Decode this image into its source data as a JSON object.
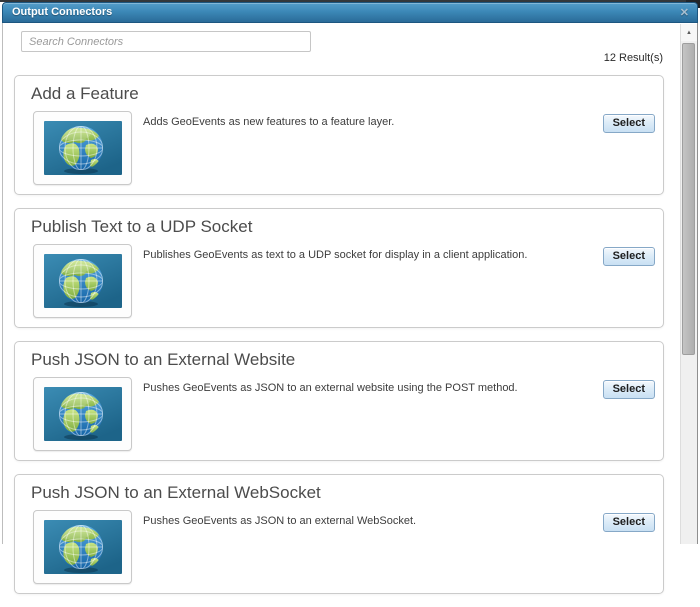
{
  "window": {
    "title": "Output Connectors"
  },
  "icons": {
    "close": "✕",
    "scroll_up": "▲"
  },
  "search": {
    "placeholder": "Search Connectors",
    "value": ""
  },
  "results_count": "12 Result(s)",
  "connectors": [
    {
      "name": "Add a Feature",
      "description": "Adds GeoEvents as new features to a feature layer.",
      "select_label": "Select",
      "icon": "globe-icon"
    },
    {
      "name": "Publish Text to a UDP Socket",
      "description": "Publishes GeoEvents as text to a UDP socket for display in a client application.",
      "select_label": "Select",
      "icon": "globe-icon"
    },
    {
      "name": "Push JSON to an External Website",
      "description": "Pushes GeoEvents as JSON to an external website using the POST method.",
      "select_label": "Select",
      "icon": "globe-icon"
    },
    {
      "name": "Push JSON to an External WebSocket",
      "description": "Pushes GeoEvents as JSON to an external WebSocket.",
      "select_label": "Select",
      "icon": "globe-icon"
    }
  ],
  "colors": {
    "titlebar_top": "#549dca",
    "titlebar_bottom": "#2a6b98",
    "button_border": "#86a8c7",
    "globe_bg_top": "#3b8cb4",
    "globe_bg_bottom": "#1d6489",
    "ocean": "#1565a8",
    "land": "#a9cf62"
  }
}
